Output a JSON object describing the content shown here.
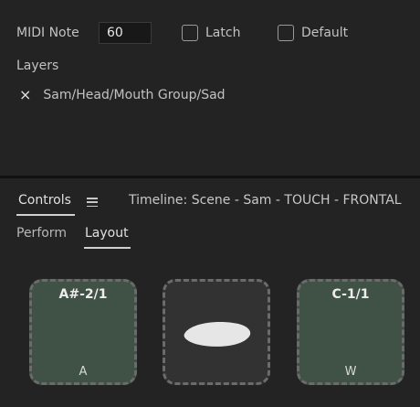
{
  "midi": {
    "label": "MIDI Note",
    "value": "60",
    "latch_label": "Latch",
    "default_label": "Default"
  },
  "layers": {
    "heading": "Layers",
    "remove_symbol": "×",
    "items": [
      {
        "path": "Sam/Head/Mouth Group/Sad"
      }
    ]
  },
  "panel": {
    "tab_controls": "Controls",
    "timeline_title": "Timeline: Scene - Sam - TOUCH - FRONTAL",
    "subtab_perform": "Perform",
    "subtab_layout": "Layout",
    "active_subtab": "Layout"
  },
  "triggers": [
    {
      "title": "A#-2/1",
      "key": "A",
      "style": "green"
    },
    {
      "title": "",
      "key": "",
      "style": "dark",
      "content": "mouth-shape-thumbnail"
    },
    {
      "title": "C-1/1",
      "key": "W",
      "style": "green"
    }
  ],
  "colors": {
    "background": "#232323",
    "trigger_green": "#3f5245",
    "trigger_dark": "#323232",
    "dashed_border": "#6b6b6b"
  }
}
